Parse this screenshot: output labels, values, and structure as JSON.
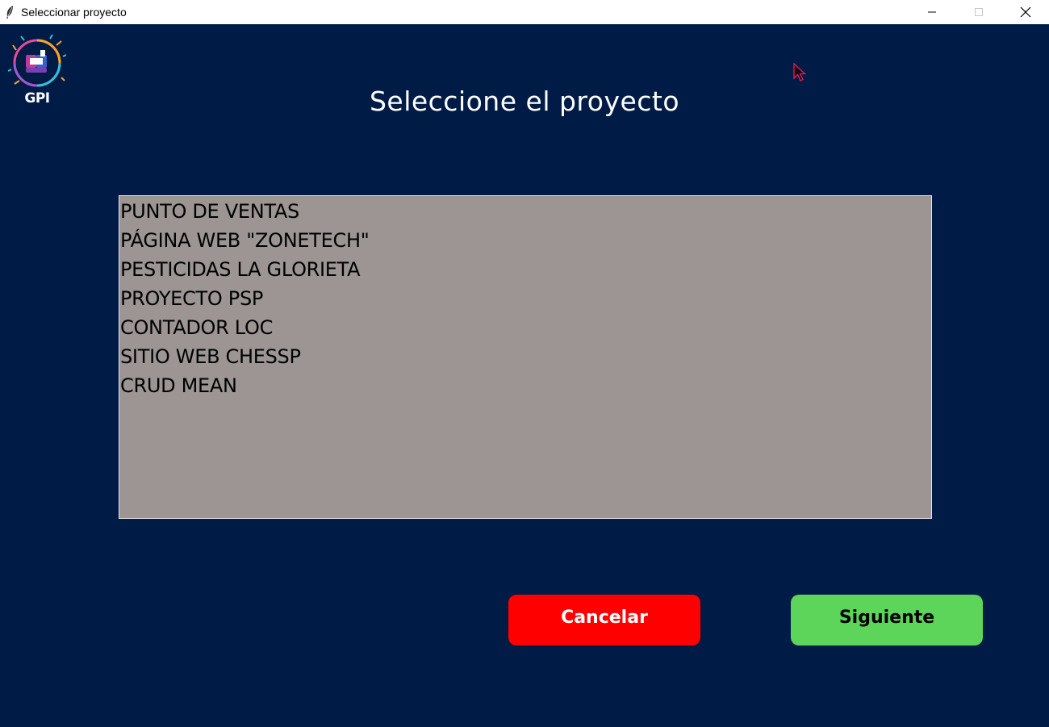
{
  "window": {
    "title": "Seleccionar proyecto",
    "controls": [
      "minimize",
      "maximize",
      "close"
    ]
  },
  "logo": {
    "text": "GPI"
  },
  "heading": "Seleccione el proyecto",
  "projects": [
    "PUNTO DE VENTAS",
    "PÁGINA WEB \"ZONETECH\"",
    "PESTICIDAS LA GLORIETA",
    "PROYECTO PSP",
    "CONTADOR LOC",
    "SITIO WEB CHESSP",
    "CRUD MEAN"
  ],
  "buttons": {
    "cancel_label": "Cancelar",
    "next_label": "Siguiente"
  },
  "colors": {
    "background": "#001c46",
    "listbox": "#9c9593",
    "cancel": "#ff0000",
    "next": "#5dd55a"
  }
}
